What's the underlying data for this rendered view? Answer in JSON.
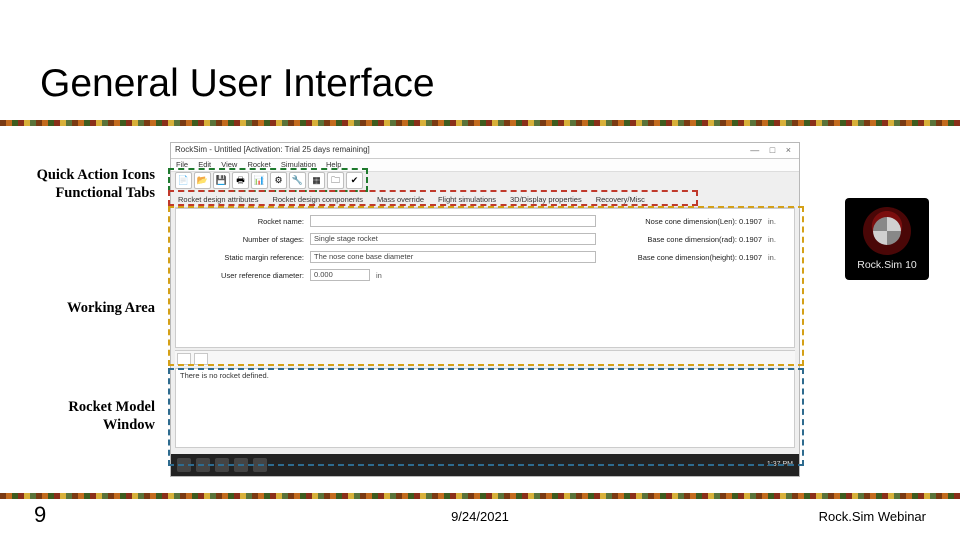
{
  "title": "General User Interface",
  "labels": {
    "quick_action_icons": "Quick Action Icons",
    "functional_tabs": "Functional Tabs",
    "working_area": "Working Area",
    "rocket_model_window": "Rocket Model\nWindow"
  },
  "app": {
    "window_title": "RockSim - Untitled  [Activation: Trial 25 days remaining]",
    "win_btns": "—  □  ×",
    "menubar": [
      "File",
      "Edit",
      "View",
      "Rocket",
      "Simulation",
      "Help"
    ],
    "toolbar_icons": [
      "new-doc-icon",
      "open-icon",
      "save-icon",
      "print-icon",
      "chart-icon",
      "gear-icon",
      "wrench-icon",
      "table-icon",
      "folder-icon",
      "check-icon"
    ],
    "tabs": [
      "Rocket design attributes",
      "Rocket design components",
      "Mass override",
      "Flight simulations",
      "3D/Display properties",
      "Recovery/Misc"
    ],
    "fields": {
      "name_label": "Rocket name:",
      "name_value": "",
      "stages_label": "Number of stages:",
      "stages_value": "Single stage rocket",
      "margin_label": "Static margin reference:",
      "margin_value": "The nose cone base diameter",
      "userref_label": "User reference diameter:",
      "userref_value": "0.000",
      "userref_unit": "in",
      "dim_len_label": "Nose cone dimension(Len): 0.1907",
      "dim_len_unit": "in.",
      "dim_rad_label": "Base cone dimension(rad): 0.1907",
      "dim_rad_unit": "in.",
      "dim_h_label": "Base cone dimension(height): 0.1907",
      "dim_h_unit": "in."
    },
    "model_msg": "There is no rocket defined.",
    "taskbar_time": "1:37 PM"
  },
  "badge": {
    "caption": "Rock.Sim 10"
  },
  "footer": {
    "page": "9",
    "date": "9/24/2021",
    "credit": "Rock.Sim Webinar"
  }
}
